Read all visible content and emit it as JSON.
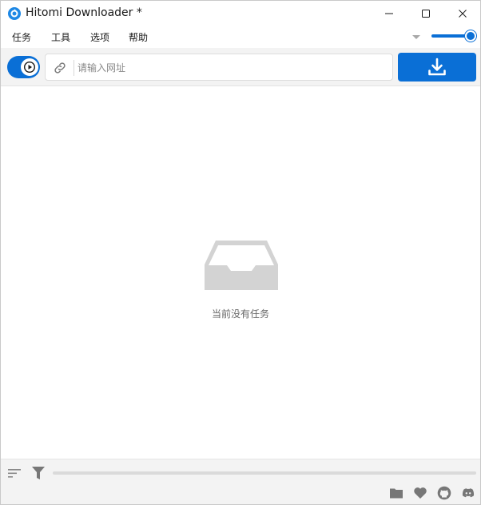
{
  "window": {
    "title": "Hitomi Downloader *",
    "accent_color": "#0a6fd6"
  },
  "menu": {
    "items": [
      {
        "label": "任务"
      },
      {
        "label": "工具"
      },
      {
        "label": "选项"
      },
      {
        "label": "帮助"
      }
    ],
    "zoom_level": 1.0
  },
  "toolbar": {
    "play_state": "paused",
    "url_placeholder": "请输入网址",
    "url_value": "",
    "download_icon": "download-icon"
  },
  "main": {
    "empty_message": "当前没有任务",
    "empty_icon": "inbox-tray-icon"
  },
  "bottom": {
    "progress": 0,
    "icons": [
      "sort-icon",
      "filter-icon",
      "folder-icon",
      "heart-icon",
      "github-icon",
      "discord-icon"
    ]
  }
}
